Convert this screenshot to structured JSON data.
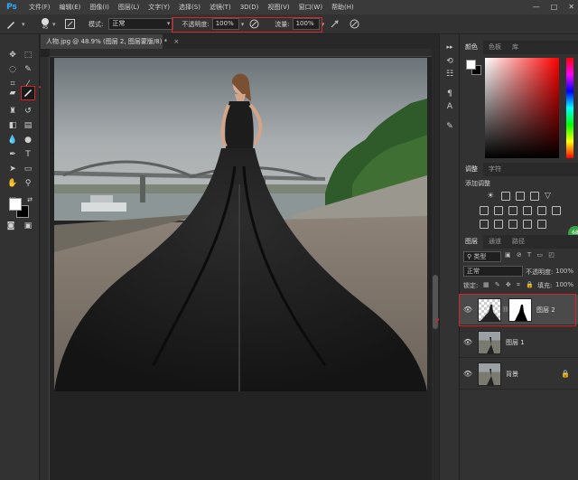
{
  "app": {
    "logo": "Ps"
  },
  "menu": [
    "文件(F)",
    "编辑(E)",
    "图像(I)",
    "图层(L)",
    "文字(Y)",
    "选择(S)",
    "滤镜(T)",
    "3D(D)",
    "视图(V)",
    "窗口(W)",
    "帮助(H)"
  ],
  "window_controls": {
    "minimize": "—",
    "maximize": "□",
    "close": "✕"
  },
  "options": {
    "brush_size": "45",
    "mode_label": "模式:",
    "mode_value": "正常",
    "opacity_label": "不透明度:",
    "opacity_value": "100%",
    "flow_label": "流量:",
    "flow_value": "100%"
  },
  "document": {
    "tab_title": "人物.jpg @ 48.9% (图层 2, 图层蒙版/8) *",
    "tab_close": "×"
  },
  "panels": {
    "color_tabs": [
      "颜色",
      "色板",
      "库"
    ],
    "adjust_tabs": [
      "调整",
      "字符"
    ],
    "adjust_title": "添加调整",
    "layers_tabs": [
      "图层",
      "通道",
      "路径"
    ],
    "kind_label": "类型",
    "blend_mode": "正常",
    "opacity_label": "不透明度:",
    "opacity_value": "100%",
    "lock_label": "锁定:",
    "fill_label": "填充:",
    "fill_value": "100%",
    "badge": "68"
  },
  "layers": [
    {
      "name": "图层 2",
      "selected": true,
      "has_mask": true
    },
    {
      "name": "图层 1",
      "selected": false,
      "has_mask": false
    },
    {
      "name": "背景",
      "selected": false,
      "has_mask": false,
      "locked": true
    }
  ],
  "colors": {
    "accent_red": "#d4262a",
    "ps_blue": "#31a8ff",
    "fg": "#ffffff",
    "bg": "#000000"
  }
}
